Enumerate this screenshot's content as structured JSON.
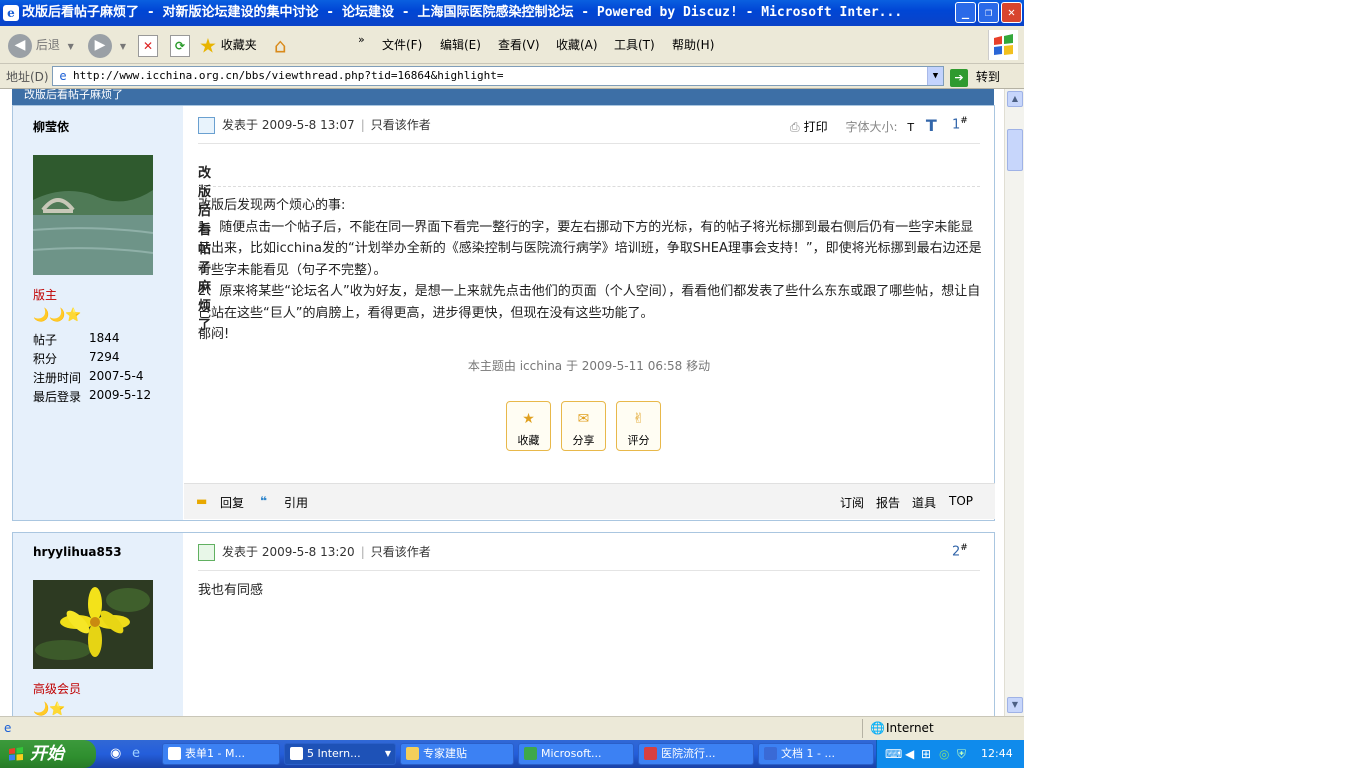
{
  "window": {
    "title": "改版后看帖子麻烦了 - 对新版论坛建设的集中讨论 - 论坛建设 - 上海国际医院感染控制论坛 - Powered by Discuz! - Microsoft Inter...",
    "min": "_",
    "max": "❐",
    "close": "✕"
  },
  "toolbar": {
    "back": "后退",
    "favorites": "收藏夹",
    "more": "»",
    "menu": [
      "文件(F)",
      "编辑(E)",
      "查看(V)",
      "收藏(A)",
      "工具(T)",
      "帮助(H)"
    ]
  },
  "address": {
    "label": "地址(D)",
    "url": "http://www.icchina.org.cn/bbs/viewthread.php?tid=16864&highlight=",
    "go": "转到"
  },
  "page": {
    "band_text": "改版后看帖子麻烦了"
  },
  "post1": {
    "username": "柳莹依",
    "role": "版主",
    "stars": "🌙🌙⭐",
    "stats": [
      {
        "label": "帖子",
        "value": "1844"
      },
      {
        "label": "积分",
        "value": "7294"
      },
      {
        "label": "注册时间",
        "value": "2007-5-4"
      },
      {
        "label": "最后登录",
        "value": "2009-5-12"
      }
    ],
    "posted": "发表于 2009-5-8 13:07",
    "only_author": "只看该作者",
    "print": "打印",
    "font_size_label": "字体大小:",
    "font_small": "T",
    "font_big": "T",
    "floor": "1",
    "floor_mark": "#",
    "title": "改版后看帖子麻烦了",
    "body": [
      "改版后发现两个烦心的事:",
      "1、随便点击一个帖子后，不能在同一界面下看完一整行的字，要左右挪动下方的光标，有的帖子将光标挪到最右侧后仍有一些字未能显示出来，比如icchina发的“计划举办全新的《感染控制与医院流行病学》培训班，争取SHEA理事会支持！”，即使将光标挪到最右边还是有些字未能看见（句子不完整）。",
      "2、原来将某些“论坛名人”收为好友，是想一上来就先点击他们的页面（个人空间），看看他们都发表了些什么东东或跟了哪些帖，想让自己站在这些“巨人”的肩膀上，看得更高，进步得更快，但现在没有这些功能了。",
      "郁闷!"
    ],
    "moved_note": "本主题由 icchina 于 2009-5-11 06:58 移动",
    "actions": [
      {
        "icon": "star-icon",
        "label": "收藏"
      },
      {
        "icon": "envelope-icon",
        "label": "分享"
      },
      {
        "icon": "thumb-icon",
        "label": "评分"
      }
    ],
    "reply": "回复",
    "quote": "引用",
    "footer_links": [
      "订阅",
      "报告",
      "道具",
      "TOP"
    ]
  },
  "post2": {
    "username": "hryylihua853",
    "role": "高级会员",
    "stars": "🌙⭐",
    "posted": "发表于 2009-5-8 13:20",
    "only_author": "只看该作者",
    "floor": "2",
    "floor_mark": "#",
    "body": "我也有同感"
  },
  "status": {
    "zone": "Internet"
  },
  "taskbar": {
    "start": "开始",
    "tasks": [
      "表单1 - M...",
      "5 Intern...",
      "专家建贴",
      "Microsoft...",
      "医院流行...",
      "文档 1 - ..."
    ],
    "clock": "12:44"
  },
  "colors": {
    "title_blue": "#0046d5",
    "band_blue": "#3d6fa6",
    "side_bg": "#e6f0fb",
    "role_red": "#c00000",
    "floor_blue": "#3366aa",
    "taskbar_blue": "#245edb",
    "start_green": "#2f8f2f"
  }
}
